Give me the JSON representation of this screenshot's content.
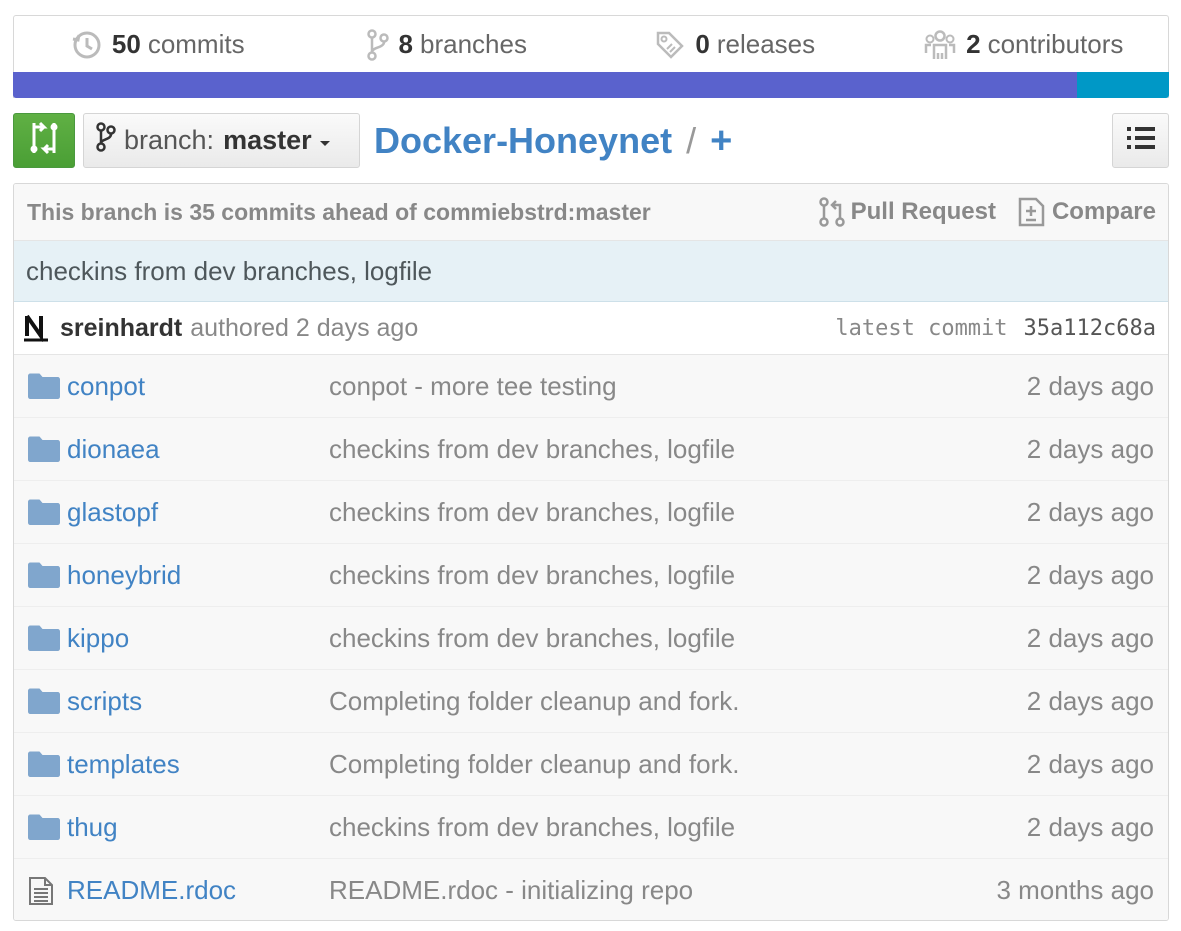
{
  "stats": {
    "commits": {
      "count": "50",
      "label": "commits"
    },
    "branches": {
      "count": "8",
      "label": "branches"
    },
    "releases": {
      "count": "0",
      "label": "releases"
    },
    "contributors": {
      "count": "2",
      "label": "contributors"
    }
  },
  "language_bar": [
    {
      "share": 92,
      "color": "#5a62cd"
    },
    {
      "share": 8,
      "color": "#0098c6"
    }
  ],
  "toolbar": {
    "branch_prefix": "branch:",
    "branch_name": "master",
    "repo_name": "Docker-Honeynet",
    "separator": "/",
    "add_file": "+"
  },
  "branch_status": {
    "message": "This branch is 35 commits ahead of commiebstrd:master",
    "pull_request": "Pull Request",
    "compare": "Compare"
  },
  "latest_commit": {
    "message": "checkins from dev branches, logfile",
    "author": "sreinhardt",
    "authored": "authored 2 days ago",
    "sha_label": "latest commit",
    "sha": "35a112c68a"
  },
  "files": [
    {
      "name": "conpot",
      "type": "folder",
      "message": "conpot - more tee testing",
      "age": "2 days ago"
    },
    {
      "name": "dionaea",
      "type": "folder",
      "message": "checkins from dev branches, logfile",
      "age": "2 days ago"
    },
    {
      "name": "glastopf",
      "type": "folder",
      "message": "checkins from dev branches, logfile",
      "age": "2 days ago"
    },
    {
      "name": "honeybrid",
      "type": "folder",
      "message": "checkins from dev branches, logfile",
      "age": "2 days ago"
    },
    {
      "name": "kippo",
      "type": "folder",
      "message": "checkins from dev branches, logfile",
      "age": "2 days ago"
    },
    {
      "name": "scripts",
      "type": "folder",
      "message": "Completing folder cleanup and fork.",
      "age": "2 days ago"
    },
    {
      "name": "templates",
      "type": "folder",
      "message": "Completing folder cleanup and fork.",
      "age": "2 days ago"
    },
    {
      "name": "thug",
      "type": "folder",
      "message": "checkins from dev branches, logfile",
      "age": "2 days ago"
    },
    {
      "name": "README.rdoc",
      "type": "file",
      "message": "README.rdoc - initializing repo",
      "age": "3 months ago"
    }
  ],
  "colors": {
    "link": "#4183c4",
    "compare_button": "#60b044",
    "commit_banner": "#e6f1f6"
  },
  "icons": {
    "commits": "history-icon",
    "branches": "git-branch-icon",
    "releases": "tag-icon",
    "contributors": "organization-icon",
    "compare_button": "git-compare-icon",
    "list_button": "list-unordered-icon",
    "pull_request": "git-pull-request-icon",
    "compare": "diff-icon",
    "folder": "file-directory-icon",
    "file": "file-text-icon"
  }
}
